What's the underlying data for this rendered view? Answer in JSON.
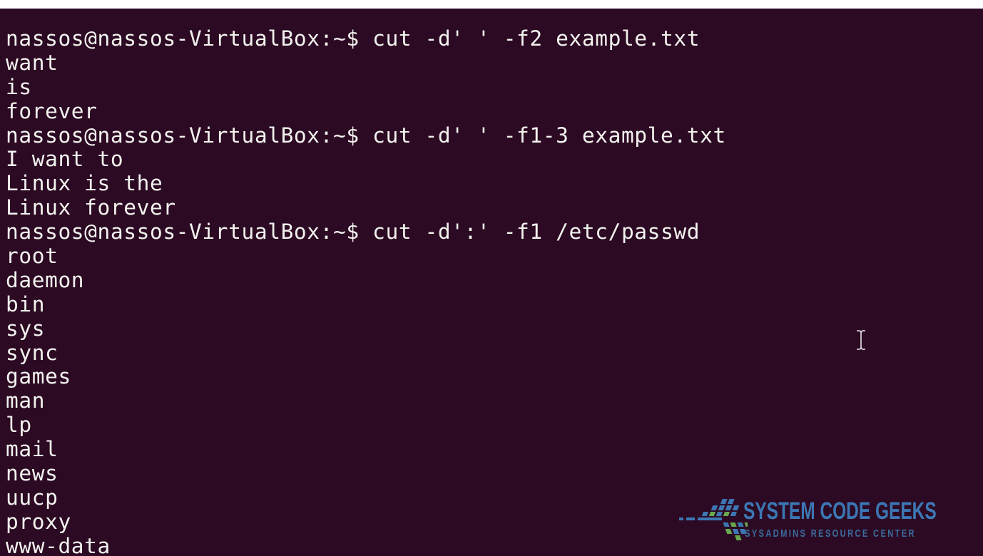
{
  "terminal": {
    "prompt": "nassos@nassos-VirtualBox:~$",
    "lines": [
      {
        "kind": "command",
        "text": "nassos@nassos-VirtualBox:~$ cut -d' ' -f2 example.txt"
      },
      {
        "kind": "output",
        "text": "want"
      },
      {
        "kind": "output",
        "text": "is"
      },
      {
        "kind": "output",
        "text": "forever"
      },
      {
        "kind": "command",
        "text": "nassos@nassos-VirtualBox:~$ cut -d' ' -f1-3 example.txt"
      },
      {
        "kind": "output",
        "text": "I want to"
      },
      {
        "kind": "output",
        "text": "Linux is the"
      },
      {
        "kind": "output",
        "text": "Linux forever"
      },
      {
        "kind": "command",
        "text": "nassos@nassos-VirtualBox:~$ cut -d':' -f1 /etc/passwd"
      },
      {
        "kind": "output",
        "text": "root"
      },
      {
        "kind": "output",
        "text": "daemon"
      },
      {
        "kind": "output",
        "text": "bin"
      },
      {
        "kind": "output",
        "text": "sys"
      },
      {
        "kind": "output",
        "text": "sync"
      },
      {
        "kind": "output",
        "text": "games"
      },
      {
        "kind": "output",
        "text": "man"
      },
      {
        "kind": "output",
        "text": "lp"
      },
      {
        "kind": "output",
        "text": "mail"
      },
      {
        "kind": "output",
        "text": "news"
      },
      {
        "kind": "output",
        "text": "uucp"
      },
      {
        "kind": "output",
        "text": "proxy"
      },
      {
        "kind": "output",
        "text": "www-data"
      }
    ]
  },
  "watermark": {
    "title": "SYSTEM CODE GEEKS",
    "subtitle": "SYSADMINS RESOURCE CENTER",
    "icon": "systemcodegeeks-logo-icon"
  },
  "cursor": {
    "icon": "text-cursor-ibeam-icon"
  },
  "colors": {
    "background": "#2c0a23",
    "foreground": "#f2f2ee",
    "watermark_blue": "#3c77b4",
    "watermark_green": "#6aa84f"
  }
}
